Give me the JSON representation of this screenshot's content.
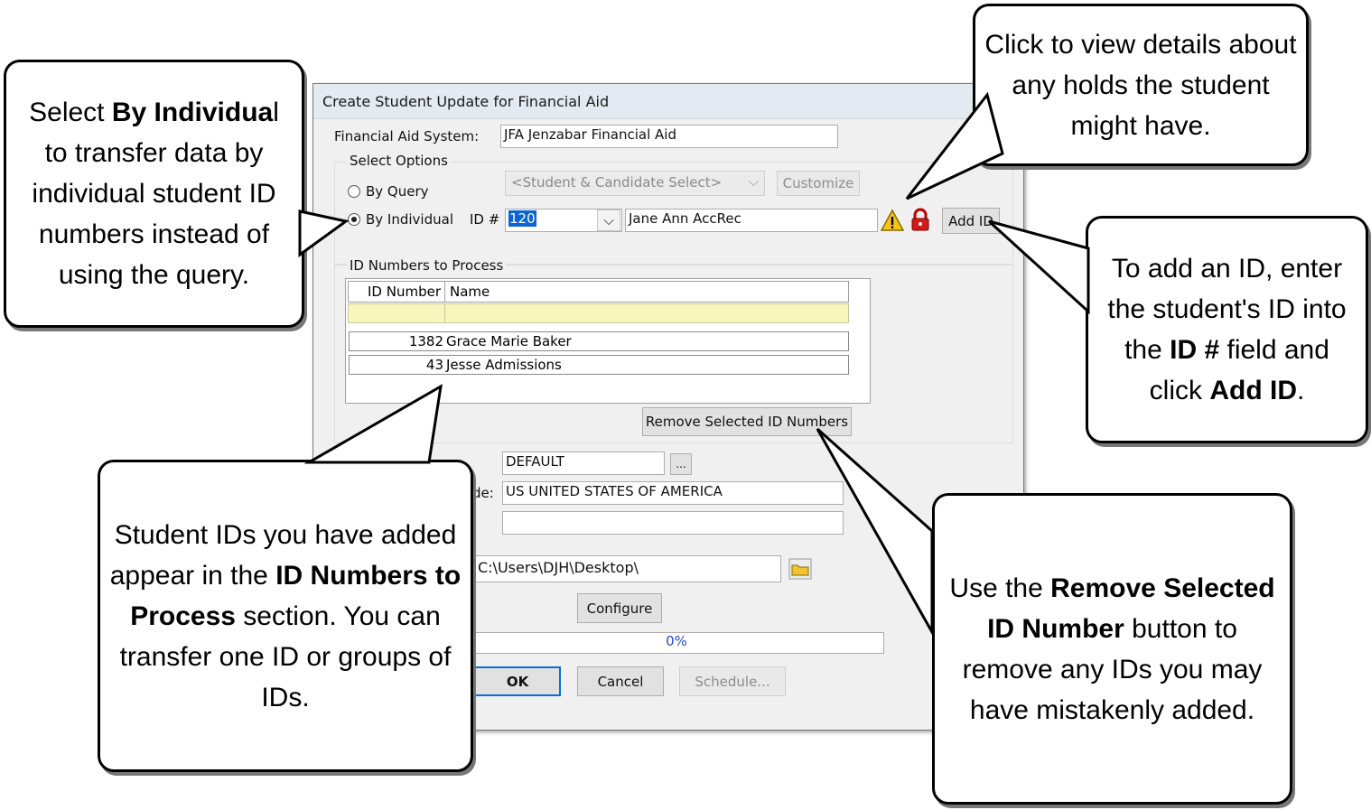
{
  "dialog": {
    "title": "Create Student Update for Financial Aid",
    "fa_system_label": "Financial Aid System:",
    "fa_system_value": "JFA   Jenzabar Financial Aid",
    "select_options_label": "Select Options",
    "by_query_label": "By Query",
    "by_individual_label": "By Individual",
    "query_select_value": "<Student & Candidate Select>",
    "customize_label": "Customize",
    "id_label": "ID #",
    "id_value": "120",
    "student_name": "Jane Ann AccRec",
    "add_id_label": "Add ID",
    "id_numbers_group_label": "ID Numbers to Process",
    "grid_headers": [
      "ID Number",
      "Name"
    ],
    "grid_rows": [
      {
        "id": "1382",
        "name": "Grace Marie Baker"
      },
      {
        "id": "43",
        "name": "Jesse Admissions"
      }
    ],
    "remove_button_label": "Remove Selected ID Numbers",
    "default_value": "DEFAULT",
    "browse_label": "...",
    "code_label_fragment": "de:",
    "country_value": "US   UNITED STATES OF AMERICA",
    "path_value": "C:\\Users\\DJH\\Desktop\\",
    "configure_label": "Configure",
    "progress_text": "0%",
    "ok_label": "OK",
    "cancel_label": "Cancel",
    "schedule_label": "Schedule..."
  },
  "callouts": {
    "by_individual": {
      "pre": "Select ",
      "bold": "By Individua",
      "post": "l to transfer data by individual student ID numbers instead of using the query."
    },
    "holds": {
      "text": "Click to view details about any holds the student might have."
    },
    "add_id": {
      "p1": "To add an ID, enter the student's ID into the ",
      "b1": "ID #",
      "p2": " field and click ",
      "b2": "Add ID",
      "p3": "."
    },
    "ids_added": {
      "p1": "Student IDs you have added appear in the ",
      "b1": "ID Numbers to Process",
      "p2": " section. You can transfer one ID or groups of IDs."
    },
    "remove": {
      "p1": "Use the ",
      "b1": "Remove Selected ID Number",
      "p2": " button to remove any IDs you may have mistakenly added."
    }
  }
}
